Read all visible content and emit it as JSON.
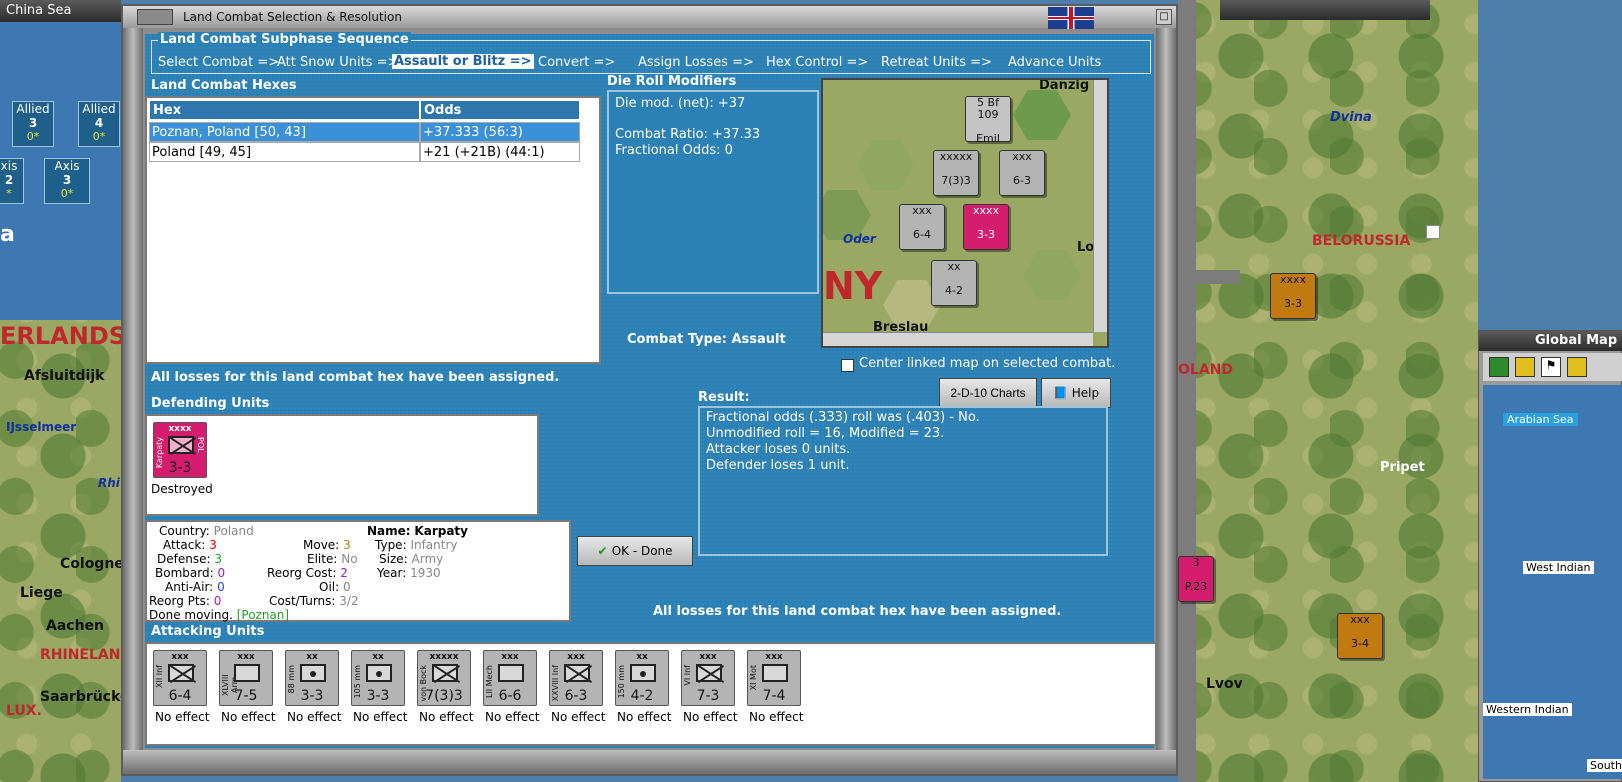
{
  "background": {
    "china_sea_label": "China Sea",
    "global_map_title": "Global Map",
    "map_labels": {
      "netherlands": "ERLANDS",
      "afsluitdijk": "Afsluitdijk",
      "ijsselmeer": "IJsselmeer",
      "rhine": "Rhi",
      "cologne": "Cologne",
      "liege": "Liege",
      "aachen": "Aachen",
      "rhineland": "RHINELAN",
      "saarbrucken": "Saarbrücke",
      "lux": "LUX.",
      "belorussia": "BELORUSSIA",
      "dvina": "Dvina",
      "poland": "OLAND",
      "pripet": "Pripet",
      "lvov": "Lvov",
      "arabian_sea": "Arabian Sea",
      "west_indian": "West Indian",
      "western_indian": "Western Indian",
      "south": "South",
      "a_label": "a"
    },
    "side_tiles": [
      {
        "side": "Allied",
        "value": "3",
        "sub": "0*"
      },
      {
        "side": "Allied",
        "value": "4",
        "sub": "0*"
      },
      {
        "side": "Axis",
        "value": "2",
        "sub": "*"
      },
      {
        "side": "Axis",
        "value": "3",
        "sub": "0*"
      }
    ]
  },
  "dialog": {
    "title": "Land Combat Selection & Resolution",
    "subphase": {
      "legend": "Land Combat Subphase Sequence",
      "steps": [
        "Select Combat =>",
        "Att Snow Units =>",
        "Assault or Blitz =>",
        "Convert =>",
        "Assign Losses =>",
        "Hex Control =>",
        "Retreat Units =>",
        "Advance Units"
      ]
    },
    "hexes": {
      "title": "Land Combat Hexes",
      "col_hex": "Hex",
      "col_odds": "Odds",
      "rows": [
        {
          "hex": "Poznan, Poland [50, 43]",
          "odds": "+37.333 (56:3)"
        },
        {
          "hex": "Poland [49, 45]",
          "odds": "+21 (+21B) (44:1)"
        }
      ]
    },
    "die_roll": {
      "title": "Die Roll Modifiers",
      "net": "Die mod. (net): +37",
      "ratio": "Combat Ratio: +37.33",
      "fractional": "Fractional Odds: 0"
    },
    "minimap": {
      "labels": {
        "danzig": "Danzig",
        "oder": "Oder",
        "breslau": "Breslau",
        "ny": "NY",
        "lo": "Lo"
      },
      "units": [
        {
          "size": "5",
          "str": "Emil",
          "type": "Bf 109"
        },
        {
          "size": "xxxxx",
          "str": "7(3)3"
        },
        {
          "size": "xxx",
          "str": "6-3"
        },
        {
          "size": "xxx",
          "str": "6-4"
        },
        {
          "size": "xxxx",
          "str": "3-3"
        },
        {
          "size": "xx",
          "str": "4-2"
        }
      ]
    },
    "combat_type": "Combat Type:  Assault",
    "center_checkbox": "Center linked map on selected combat.",
    "losses_note": "All losses for this land combat hex have been assigned.",
    "losses_note_2": "All losses for this land combat hex have been assigned.",
    "charts_button": "2-D-10 Charts",
    "help_button": "Help",
    "ok_button": "OK - Done",
    "defending": {
      "title": "Defending Units",
      "unit": {
        "size": "xxxx",
        "name": "Karpaty",
        "nation": "POL",
        "str": "3-3"
      },
      "status": "Destroyed"
    },
    "result": {
      "title": "Result:",
      "lines": [
        "Fractional odds (.333) roll was (.403)  - No.",
        "Unmodified roll = 16, Modified = 23.",
        "Attacker loses 0 units.",
        "Defender loses 1 unit."
      ]
    },
    "unit_info": {
      "country_k": "Country:",
      "country_v": "Poland",
      "attack_k": "Attack:",
      "attack_v": "3",
      "defense_k": "Defense:",
      "defense_v": "3",
      "bombard_k": "Bombard:",
      "bombard_v": "0",
      "antiair_k": "Anti-Air:",
      "antiair_v": "0",
      "reorgpts_k": "Reorg Pts:",
      "reorgpts_v": "0",
      "move_k": "Move:",
      "move_v": "3",
      "elite_k": "Elite:",
      "elite_v": "No",
      "reorgcost_k": "Reorg Cost:",
      "reorgcost_v": "2",
      "oil_k": "Oil:",
      "oil_v": "0",
      "costturns_k": "Cost/Turns:",
      "costturns_v": "3/2",
      "name_k": "Name:",
      "name_v": "Karpaty",
      "type_k": "Type:",
      "type_v": "Infantry",
      "size_k": "Size:",
      "size_v": "Army",
      "year_k": "Year:",
      "year_v": "1930",
      "done_text": "Done moving.",
      "done_loc": "[Poznan]"
    },
    "attacking": {
      "title": "Attacking Units",
      "units": [
        {
          "size": "xxx",
          "side": "XII Inf",
          "str": "6-4",
          "kind": "inf",
          "effect": "No effect"
        },
        {
          "size": "xxx",
          "side": "XLVIII Arm",
          "str": "7-5",
          "kind": "arm",
          "effect": "No effect"
        },
        {
          "size": "xx",
          "side": "88 mm",
          "str": "3-3",
          "kind": "aa",
          "effect": "No effect"
        },
        {
          "size": "xx",
          "side": "105 mm",
          "str": "3-3",
          "kind": "art",
          "effect": "No effect"
        },
        {
          "size": "xxxxx",
          "side": "von Bock",
          "str": "7(3)3",
          "kind": "inf",
          "effect": "No effect"
        },
        {
          "size": "xxx",
          "side": "LII Mech",
          "str": "6-6",
          "kind": "mech",
          "effect": "No effect"
        },
        {
          "size": "xxx",
          "side": "XXVIII Inf",
          "str": "6-3",
          "kind": "inf",
          "effect": "No effect"
        },
        {
          "size": "xx",
          "side": "150 mm",
          "str": "4-2",
          "kind": "art",
          "effect": "No effect"
        },
        {
          "size": "xxx",
          "side": "VI Inf",
          "str": "7-3",
          "kind": "inf",
          "effect": "No effect"
        },
        {
          "size": "xxx",
          "side": "XI Mot",
          "str": "7-4",
          "kind": "mech",
          "effect": "No effect"
        }
      ]
    }
  },
  "colors": {
    "accent": "#2b80b5",
    "selected_row": "#3b91d8",
    "polish_unit": "#d51d6e",
    "red_value": "#e00000",
    "green_value": "#2a9d2a"
  }
}
